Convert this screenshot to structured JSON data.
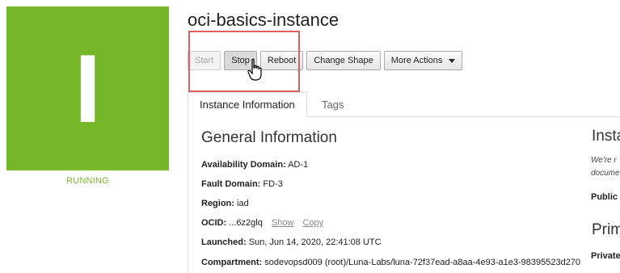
{
  "status": {
    "letter": "I",
    "label": "RUNNING",
    "color": "#76b82a"
  },
  "instance": {
    "title": "oci-basics-instance"
  },
  "actions": {
    "start": "Start",
    "stop": "Stop",
    "reboot": "Reboot",
    "change_shape": "Change Shape",
    "more_actions": "More Actions"
  },
  "tabs": [
    {
      "label": "Instance Information",
      "active": true
    },
    {
      "label": "Tags",
      "active": false
    }
  ],
  "general": {
    "title": "General Information",
    "availability_domain": {
      "label": "Availability Domain:",
      "value": "AD-1"
    },
    "fault_domain": {
      "label": "Fault Domain:",
      "value": "FD-3"
    },
    "region": {
      "label": "Region:",
      "value": "iad"
    },
    "ocid": {
      "label": "OCID:",
      "value": "...6z2glq",
      "show": "Show",
      "copy": "Copy"
    },
    "launched": {
      "label": "Launched:",
      "value": "Sun, Jun 14, 2020, 22:41:08 UTC"
    },
    "compartment": {
      "label": "Compartment:",
      "value": "sodevopsd009 (root)/Luna-Labs/luna-72f37ead-a8aa-4e93-a1e3-98395523d270"
    }
  },
  "right_column": {
    "heading1": "Insta",
    "note1": "We're r",
    "note2": "docume",
    "public": "Public",
    "heading2": "Prim",
    "private": "Private"
  }
}
